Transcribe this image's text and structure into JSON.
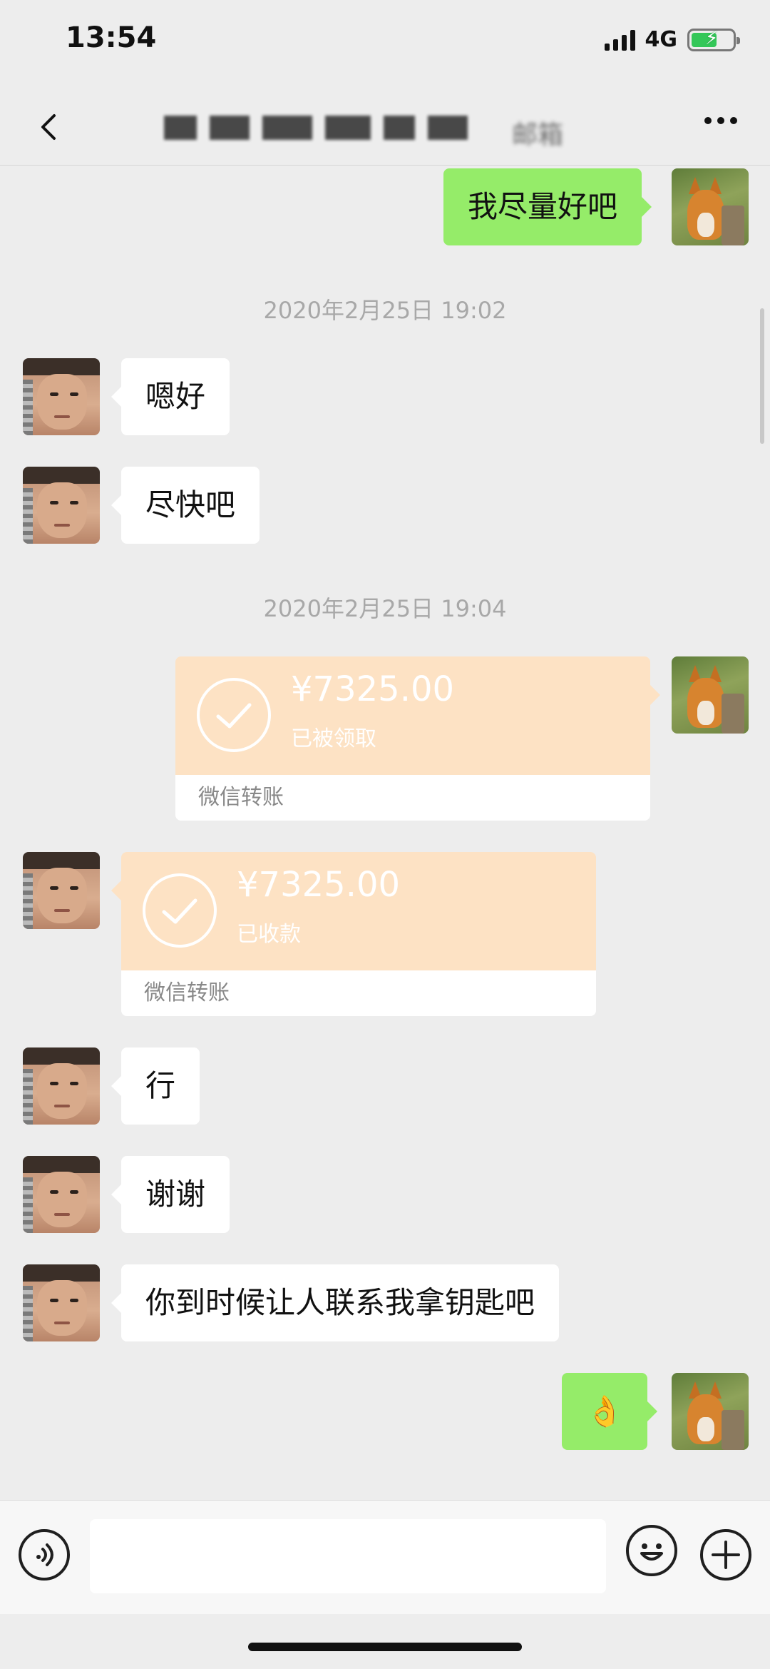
{
  "status_bar": {
    "time": "13:54",
    "network": "4G"
  },
  "nav": {
    "title": "邮箱"
  },
  "messages": {
    "m1": "我尽量好吧",
    "ts1": "2020年2月25日 19:02",
    "m2": "嗯好",
    "m3": "尽快吧",
    "ts2": "2020年2月25日 19:04",
    "transfer_out": {
      "amount": "¥7325.00",
      "status": "已被领取",
      "label": "微信转账"
    },
    "transfer_in": {
      "amount": "¥7325.00",
      "status": "已收款",
      "label": "微信转账"
    },
    "m4": "行",
    "m5": "谢谢",
    "m6": "你到时候让人联系我拿钥匙吧",
    "m7": "👌"
  },
  "colors": {
    "outgoing_bubble": "#95ec69",
    "incoming_bubble": "#ffffff",
    "transfer": "#fde2c4",
    "background": "#ededed"
  },
  "icons": [
    "back-icon",
    "more-icon",
    "voice-icon",
    "emoji-icon",
    "plus-icon",
    "check-icon"
  ]
}
